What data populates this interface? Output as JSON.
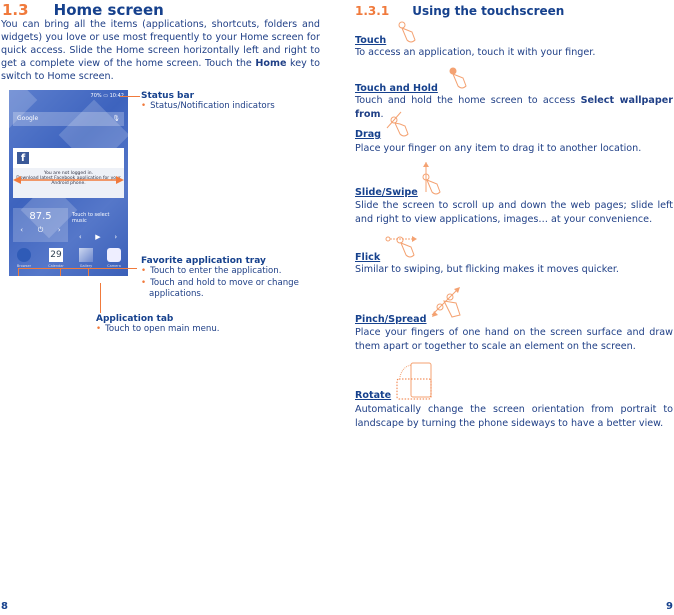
{
  "left_page": {
    "section_number": "1.3",
    "section_title": "Home screen",
    "intro_part1": "You can bring all the items (applications, shortcuts, folders and widgets) you love or use most frequently to your Home screen for quick access. Slide the Home screen horizontally left and right to get a complete view of the home screen. Touch the ",
    "intro_bold": "Home",
    "intro_part2": " key to switch to Home screen.",
    "phone": {
      "status_text": "70%",
      "status_time": "10:42",
      "search_label": "Google",
      "fb_message_title": "You are not logged in.",
      "fb_message_body": "Download latest Facebook application for your Android phone.",
      "radio_frequency": "87.5",
      "music_label": "Touch to select music",
      "calendar_day": "29",
      "apps": [
        "Browser",
        "Calendar",
        "Gallery",
        "Camera"
      ]
    },
    "annotations": {
      "status_bar": {
        "title": "Status bar",
        "items": [
          "Status/Notification indicators"
        ]
      },
      "favorite_tray": {
        "title": "Favorite application tray",
        "items": [
          "Touch to enter the application.",
          "Touch and hold to move or change applications."
        ]
      },
      "application_tab": {
        "title": "Application tab",
        "items": [
          "Touch to open main menu."
        ]
      }
    },
    "page_number": "8"
  },
  "right_page": {
    "section_number": "1.3.1",
    "section_title": "Using the touchscreen",
    "gestures": [
      {
        "title": "Touch",
        "icon": "touch-gesture-icon",
        "desc": "To access an application, touch it with your finger."
      },
      {
        "title": "Touch and Hold",
        "icon": "touch-hold-gesture-icon",
        "desc_part1": "Touch and hold the home screen to access ",
        "desc_bold": "Select wallpaper from",
        "desc_part2": "."
      },
      {
        "title": "Drag",
        "icon": "drag-gesture-icon",
        "desc": "Place your finger on any item to drag it to another location."
      },
      {
        "title": "Slide/Swipe",
        "icon": "swipe-gesture-icon",
        "desc": "Slide the screen to scroll up and down the web pages; slide left and right to view applications, images… at your convenience."
      },
      {
        "title": "Flick",
        "icon": "flick-gesture-icon",
        "desc": "Similar to swiping, but flicking makes it moves quicker."
      },
      {
        "title": "Pinch/Spread",
        "icon": "pinch-gesture-icon",
        "desc": "Place your fingers of one hand on the screen surface and draw them apart or together to scale an element on the screen."
      },
      {
        "title": "Rotate",
        "icon": "rotate-gesture-icon",
        "desc": "Automatically change the screen orientation from portrait to landscape by turning the phone sideways to have a better view."
      }
    ],
    "page_number": "9"
  },
  "colors": {
    "accent": "#f07a3c",
    "text": "#1f3f86",
    "heading": "#16418d"
  }
}
